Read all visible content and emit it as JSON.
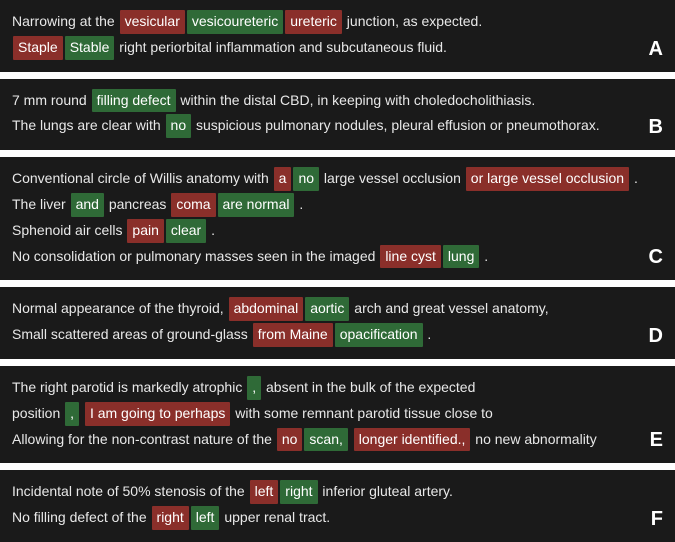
{
  "panels": [
    {
      "label": "A",
      "lines": [
        {
          "tokens": [
            {
              "t": "Narrowing at the "
            },
            {
              "t": "vesicular",
              "k": "red"
            },
            {
              "t": "vesicoureteric",
              "k": "green"
            },
            {
              "t": "ureteric",
              "k": "red"
            },
            {
              "t": " junction, as expected."
            }
          ]
        },
        {
          "tokens": [
            {
              "t": "Staple",
              "k": "red"
            },
            {
              "t": "Stable",
              "k": "green"
            },
            {
              "t": " right periorbital inflammation and subcutaneous fluid."
            }
          ]
        }
      ]
    },
    {
      "label": "B",
      "lines": [
        {
          "tokens": [
            {
              "t": "7 mm round "
            },
            {
              "t": "filling defect",
              "k": "green"
            },
            {
              "t": " within the distal CBD, in keeping with choledocholithiasis."
            }
          ]
        },
        {
          "tokens": [
            {
              "t": "The lungs are clear with "
            },
            {
              "t": "no",
              "k": "green"
            },
            {
              "t": " suspicious pulmonary nodules, pleural effusion or pneumothorax."
            }
          ]
        }
      ]
    },
    {
      "label": "C",
      "lines": [
        {
          "tokens": [
            {
              "t": "Conventional circle of Willis anatomy with "
            },
            {
              "t": "a",
              "k": "red"
            },
            {
              "t": "no",
              "k": "green"
            },
            {
              "t": " large vessel occlusion "
            },
            {
              "t": "or large vessel occlusion",
              "k": "red"
            },
            {
              "t": " ."
            }
          ]
        },
        {
          "tokens": [
            {
              "t": "The liver "
            },
            {
              "t": "and",
              "k": "green"
            },
            {
              "t": " pancreas "
            },
            {
              "t": "coma",
              "k": "red"
            },
            {
              "t": "are normal",
              "k": "green"
            },
            {
              "t": " ."
            }
          ]
        },
        {
          "tokens": [
            {
              "t": "Sphenoid air cells "
            },
            {
              "t": "pain",
              "k": "red"
            },
            {
              "t": "clear",
              "k": "green"
            },
            {
              "t": " ."
            }
          ]
        },
        {
          "tokens": [
            {
              "t": "No consolidation or pulmonary masses seen in the imaged "
            },
            {
              "t": "line cyst",
              "k": "red"
            },
            {
              "t": "lung",
              "k": "green"
            },
            {
              "t": " ."
            }
          ]
        }
      ]
    },
    {
      "label": "D",
      "lines": [
        {
          "tokens": [
            {
              "t": "Normal appearance of the thyroid, "
            },
            {
              "t": "abdominal",
              "k": "red"
            },
            {
              "t": "aortic",
              "k": "green"
            },
            {
              "t": " arch and great vessel anatomy,"
            }
          ]
        },
        {
          "tokens": [
            {
              "t": "Small scattered areas of ground-glass "
            },
            {
              "t": "from Maine",
              "k": "red"
            },
            {
              "t": "opacification",
              "k": "green"
            },
            {
              "t": " ."
            }
          ]
        }
      ]
    },
    {
      "label": "E",
      "lines": [
        {
          "tokens": [
            {
              "t": "The right parotid is markedly atrophic "
            },
            {
              "t": ",",
              "k": "green"
            },
            {
              "t": " absent in the bulk of the expected"
            }
          ]
        },
        {
          "tokens": [
            {
              "t": "position "
            },
            {
              "t": ",",
              "k": "green"
            },
            {
              "t": " "
            },
            {
              "t": "I am going to perhaps",
              "k": "red"
            },
            {
              "t": " with some remnant parotid tissue close to "
            }
          ]
        },
        {
          "tokens": [
            {
              "t": "Allowing for the non-contrast nature of the "
            },
            {
              "t": "no",
              "k": "red"
            },
            {
              "t": "scan,",
              "k": "green"
            },
            {
              "t": " "
            },
            {
              "t": "longer identified.,",
              "k": "red"
            },
            {
              "t": " no new abnormality"
            }
          ]
        }
      ]
    },
    {
      "label": "F",
      "lines": [
        {
          "tokens": [
            {
              "t": "Incidental note of 50% stenosis of the "
            },
            {
              "t": "left",
              "k": "red"
            },
            {
              "t": "right",
              "k": "green"
            },
            {
              "t": " inferior gluteal artery."
            }
          ]
        },
        {
          "tokens": [
            {
              "t": "No filling defect of the "
            },
            {
              "t": "right",
              "k": "red"
            },
            {
              "t": "left",
              "k": "green"
            },
            {
              "t": " upper renal tract."
            }
          ]
        }
      ]
    }
  ]
}
